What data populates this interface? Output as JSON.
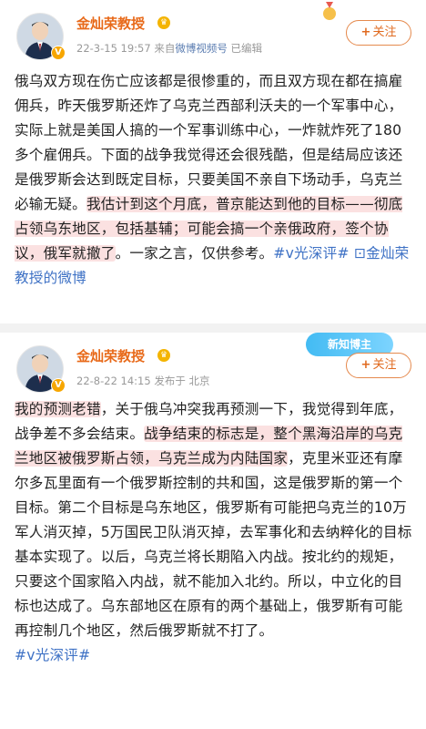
{
  "post1": {
    "author": "金灿荣教授",
    "date": "22-3-15 19:57",
    "source_prefix": "来自",
    "source_name": "微博视频号",
    "edited": "已编辑",
    "follow_label": "关注",
    "text": {
      "a": "俄乌双方现在伤亡应该都是很惨重的，而且双方现在都在搞雇佣兵，昨天俄罗斯还炸了乌克兰西部利沃夫的一个军事中心，实际上就是美国人搞的一个军事训练中心，一炸就炸死了180多个雇佣兵。下面的战争我觉得还会很残酷，但是结局应该还是俄罗斯会达到既定目标，只要美国不亲自下场动手，乌克兰必输无疑。",
      "hl1": "我估计到这个月底，普京能达到他的目标——彻底占领乌东地区，包括基辅；可能会搞一个亲俄政府，签个协议，俄军就撤了",
      "b": "。一家之言，仅供参考。",
      "tag": "#v光深评#",
      "link": "金灿荣教授的微博"
    }
  },
  "post2": {
    "author": "金灿荣教授",
    "date": "22-8-22 14:15",
    "source_prefix": "发布于",
    "location": "北京",
    "badge": "新知博主",
    "follow_label": "关注",
    "text": {
      "hl1": "我的预测老错",
      "a": "，关于俄乌冲突我再预测一下，我觉得到年底，战争差不多会结束。",
      "hl2": "战争结束的标志是，整个黑海沿岸的乌克兰地区被俄罗斯占领，乌克兰成为内陆国家",
      "b": "，克里米亚还有摩尔多瓦里面有一个俄罗斯控制的共和国，这是俄罗斯的第一个目标。第二个目标是乌东地区，俄罗斯有可能把乌克兰的10万军人消灭掉，5万国民卫队消灭掉，去军事化和去纳粹化的目标基本实现了。以后，乌克兰将长期陷入内战。按北约的规矩，只要这个国家陷入内战，就不能加入北约。所以，中立化的目标也达成了。乌东部地区在原有的两个基础上，俄罗斯有可能再控制几个地区，然后俄罗斯就不打了。",
      "tag": "#v光深评#"
    }
  },
  "colors": {
    "name": "#e86a1a",
    "highlight": "#fbe1e1",
    "link": "#3f72c5",
    "meta": "#999999"
  },
  "icons": {
    "verified": "v-badge-icon",
    "crown": "crown-icon",
    "link": "weibo-link-icon"
  }
}
